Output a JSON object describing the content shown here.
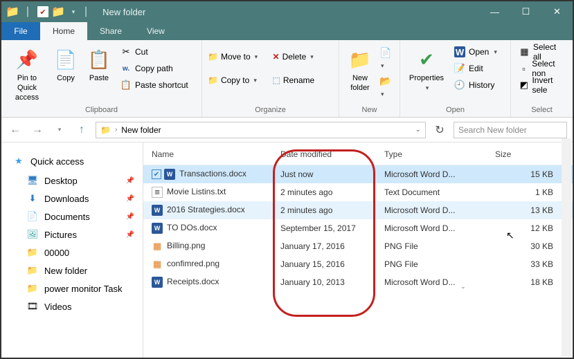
{
  "window": {
    "title": "New folder"
  },
  "tabs": {
    "file": "File",
    "home": "Home",
    "share": "Share",
    "view": "View"
  },
  "ribbon": {
    "clipboard": {
      "label": "Clipboard",
      "pin": "Pin to Quick\naccess",
      "copy": "Copy",
      "paste": "Paste",
      "cut": "Cut",
      "copyPath": "Copy path",
      "pasteShortcut": "Paste shortcut"
    },
    "organize": {
      "label": "Organize",
      "moveTo": "Move to",
      "copyTo": "Copy to",
      "delete": "Delete",
      "rename": "Rename"
    },
    "new": {
      "label": "New",
      "newFolder": "New\nfolder"
    },
    "open": {
      "label": "Open",
      "properties": "Properties",
      "open": "Open",
      "edit": "Edit",
      "history": "History"
    },
    "select": {
      "label": "Select",
      "selectAll": "Select all",
      "selectNone": "Select non",
      "invert": "Invert sele"
    }
  },
  "breadcrumb": {
    "folder": "New folder"
  },
  "search": {
    "placeholder": "Search New folder"
  },
  "sidebar": {
    "quickAccess": "Quick access",
    "desktop": "Desktop",
    "downloads": "Downloads",
    "documents": "Documents",
    "pictures": "Pictures",
    "f00000": "00000",
    "newFolder": "New folder",
    "powerMonitor": "power monitor Task",
    "videos": "Videos"
  },
  "columns": {
    "name": "Name",
    "date": "Date modified",
    "type": "Type",
    "size": "Size"
  },
  "files": [
    {
      "name": "Transactions.docx",
      "date": "Just now",
      "type": "Microsoft Word D...",
      "size": "15 KB",
      "ico": "word",
      "sel": true
    },
    {
      "name": "Movie Listins.txt",
      "date": "2 minutes ago",
      "type": "Text Document",
      "size": "1 KB",
      "ico": "txt"
    },
    {
      "name": "2016 Strategies.docx",
      "date": "2 minutes ago",
      "type": "Microsoft Word D...",
      "size": "13 KB",
      "ico": "word",
      "hov": true
    },
    {
      "name": "TO DOs.docx",
      "date": "September 15, 2017",
      "type": "Microsoft Word D...",
      "size": "12 KB",
      "ico": "word"
    },
    {
      "name": "Billing.png",
      "date": "January 17, 2016",
      "type": "PNG File",
      "size": "30 KB",
      "ico": "png"
    },
    {
      "name": "confimred.png",
      "date": "January 15, 2016",
      "type": "PNG File",
      "size": "33 KB",
      "ico": "png"
    },
    {
      "name": "Receipts.docx",
      "date": "January 10, 2013",
      "type": "Microsoft Word D...",
      "size": "18 KB",
      "ico": "word"
    }
  ]
}
